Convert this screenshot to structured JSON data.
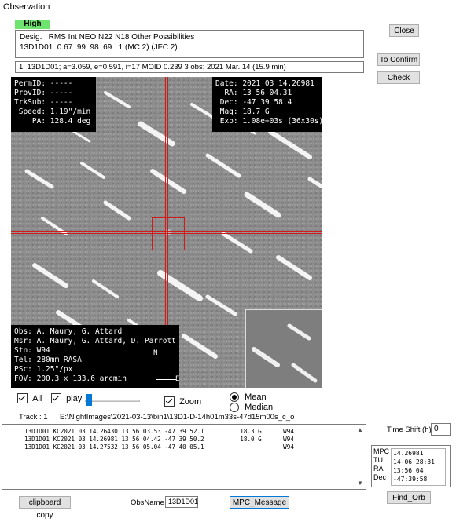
{
  "window": {
    "title": "Observation"
  },
  "buttons": {
    "close": "Close",
    "to_confirm": "To Confirm",
    "check": "Check",
    "clipboard_copy": "clipboard copy",
    "mpc_message": "MPC_Message",
    "find_orb": "Find_Orb"
  },
  "priority": {
    "label": "High",
    "color": "#6ee36e"
  },
  "desig": {
    "line1": "Desig.   RMS Int NEO N22 N18 Other Possibilities",
    "line2": "13D1D01  0.67  99  98  69   1 (MC 2) (JFC 2)"
  },
  "orbit_summary": "1: 13D1D01; a=3.059, e=0.591, i=17 MOID 0.239   3 obs; 2021 Mar. 14 (15.9 min)",
  "overlay_topleft": "PermID: -----\nProvID: -----\nTrkSub: -----\n Speed: 1.19\"/min\n    PA: 128.4 deg",
  "overlay_topright": "Date: 2021 03 14.26981\n  RA: 13 56 04.31\n Dec: -47 39 58.4\n Mag: 18.7 G\n Exp: 1.08e+03s (36x30s)",
  "overlay_bottomleft": "Obs: A. Maury, G. Attard\nMsr: A. Maury, G. Attard, D. Parrott\nStn: W94\nTel: 280mm RASA\nPSc: 1.25\"/px\nFOV: 200.3 x 133.6 arcmin",
  "compass": {
    "north": "N",
    "east": "E"
  },
  "controls": {
    "all": {
      "label": "All",
      "checked": true
    },
    "play": {
      "label": "play",
      "checked": true
    },
    "zoom": {
      "label": "Zoom",
      "checked": true
    },
    "mean": {
      "label": "Mean",
      "selected": true
    },
    "median": {
      "label": "Median",
      "selected": false
    },
    "play_speed": 0.05
  },
  "track": {
    "label": "Track : 1",
    "path": "E:\\NightImages\\2021-03-13\\bin1\\13D1-D-14h01m33s-47d15m00s_c_o"
  },
  "observations": [
    "13D1D01 KC2021 03 14.26430 13 56 03.53 -47 39 52.1          18.3 G      W94",
    "13D1D01 KC2021 03 14.26981 13 56 04.42 -47 39 50.2          18.0 G      W94",
    "13D1D01 KC2021 03 14.27532 13 56 05.04 -47 40 05.1                      W94"
  ],
  "time_shift": {
    "label": "Time Shift (h)",
    "value": "0"
  },
  "mpc": {
    "labels": [
      "MPC",
      "TU",
      "RA",
      "Dec"
    ],
    "values": [
      "14.26981",
      "14-06:28:31",
      "13:56:04",
      "-47:39:58"
    ]
  },
  "obsname": {
    "label": "ObsName",
    "value": "13D1D01"
  }
}
